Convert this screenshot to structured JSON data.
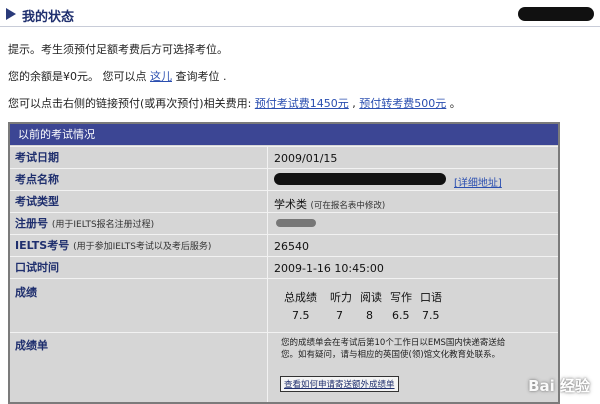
{
  "header": {
    "title": "我的状态"
  },
  "notices": {
    "tip": "提示。考生须预付足额考费后方可选择考位。",
    "balance_prefix": "您的余额是¥0元。 您可以点",
    "here_link": "这儿",
    "balance_suffix": "查询考位 .",
    "prepay_prefix": "您可以点击右侧的链接预付(或再次预付)相关费用:",
    "prepay_exam_link": "预付考试费1450元",
    "separator": ",",
    "prepay_transfer_link": "预付转考费500元",
    "end": "。"
  },
  "panel": {
    "title": "以前的考试情况",
    "rows": [
      {
        "label": "考试日期",
        "sub": "",
        "value": "2009/01/15"
      },
      {
        "label": "考点名称",
        "sub": "",
        "value": "",
        "link": "[详细地址]"
      },
      {
        "label": "考试类型",
        "sub": "",
        "value": "学术类",
        "value_note": "(可在报名表中修改)"
      },
      {
        "label": "注册号",
        "sub": "(用于IELTS报名注册过程)",
        "value": ""
      },
      {
        "label": "IELTS考号",
        "sub": "(用于参加IELTS考试以及考后服务)",
        "value": "26540"
      },
      {
        "label": "口试时间",
        "sub": "",
        "value": "2009-1-16 10:45:00"
      },
      {
        "label": "成绩",
        "sub": "",
        "value": ""
      },
      {
        "label": "成绩单",
        "sub": "",
        "value": ""
      }
    ],
    "scores": {
      "headers": [
        "总成绩",
        "听力",
        "阅读",
        "写作",
        "口语"
      ],
      "values": [
        "7.5",
        "7",
        "8",
        "6.5",
        "7.5"
      ]
    },
    "report_note": "您的成绩单会在考试后第10个工作日以EMS国内快递寄送给您。如有疑问，请与相应的英国使(领)馆文化教育处联系。",
    "report_button": "查看如何申请寄送额外成绩单"
  },
  "watermark": {
    "text": "Bai 经验"
  }
}
